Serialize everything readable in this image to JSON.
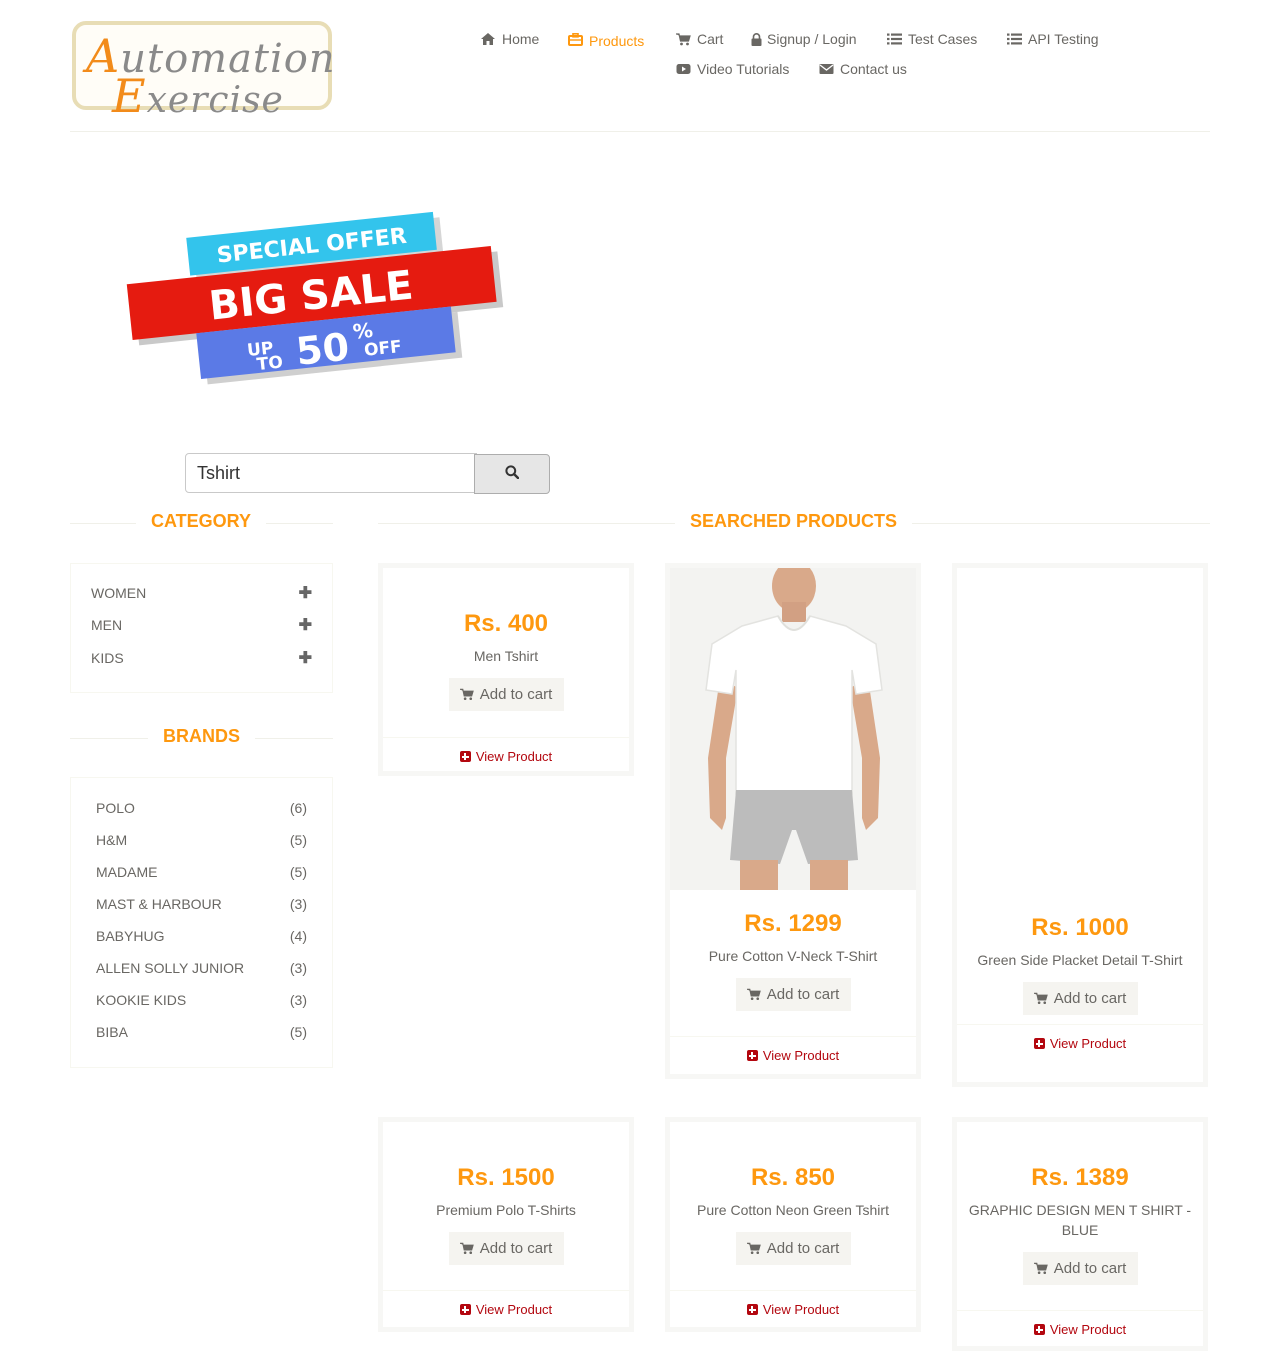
{
  "header": {
    "logo": {
      "line1": "Automation",
      "line2": "Exercise"
    },
    "nav": [
      {
        "label": "Home",
        "icon": "home-icon"
      },
      {
        "label": "Products",
        "icon": "briefcase-icon",
        "active": true
      },
      {
        "label": "Cart",
        "icon": "cart-icon"
      },
      {
        "label": "Signup / Login",
        "icon": "lock-icon"
      },
      {
        "label": "Test Cases",
        "icon": "list-icon"
      },
      {
        "label": "API Testing",
        "icon": "list-icon"
      },
      {
        "label": "Video Tutorials",
        "icon": "youtube-play-icon"
      },
      {
        "label": "Contact us",
        "icon": "envelope-icon"
      }
    ]
  },
  "banner": {
    "line1": "SPECIAL OFFER",
    "line2": "BIG SALE",
    "up": "UP",
    "to": "TO",
    "num": "50",
    "pct": "%",
    "off": "OFF"
  },
  "search": {
    "value": "Tshirt",
    "button_icon": "search-icon"
  },
  "sidebar": {
    "category_title": "Category",
    "categories": [
      "WOMEN",
      "MEN",
      "KIDS"
    ],
    "brands_title": "Brands",
    "brands": [
      {
        "name": "POLO",
        "count": "(6)"
      },
      {
        "name": "H&M",
        "count": "(5)"
      },
      {
        "name": "MADAME",
        "count": "(5)"
      },
      {
        "name": "MAST & HARBOUR",
        "count": "(3)"
      },
      {
        "name": "BABYHUG",
        "count": "(4)"
      },
      {
        "name": "ALLEN SOLLY JUNIOR",
        "count": "(3)"
      },
      {
        "name": "KOOKIE KIDS",
        "count": "(3)"
      },
      {
        "name": "BIBA",
        "count": "(5)"
      }
    ]
  },
  "products": {
    "title": "Searched Products",
    "add_label": "Add to cart",
    "view_label": "View Product",
    "items": [
      {
        "price": "Rs. 400",
        "name": "Men Tshirt"
      },
      {
        "price": "Rs. 1299",
        "name": "Pure Cotton V-Neck T-Shirt"
      },
      {
        "price": "Rs. 1000",
        "name": "Green Side Placket Detail T-Shirt"
      },
      {
        "price": "Rs. 1500",
        "name": "Premium Polo T-Shirts"
      },
      {
        "price": "Rs. 850",
        "name": "Pure Cotton Neon Green Tshirt"
      },
      {
        "price": "Rs. 1389",
        "name": "GRAPHIC DESIGN MEN T SHIRT - BLUE"
      }
    ]
  },
  "colors": {
    "accent": "#fe980f",
    "link": "#b3070f",
    "text": "#696763"
  }
}
